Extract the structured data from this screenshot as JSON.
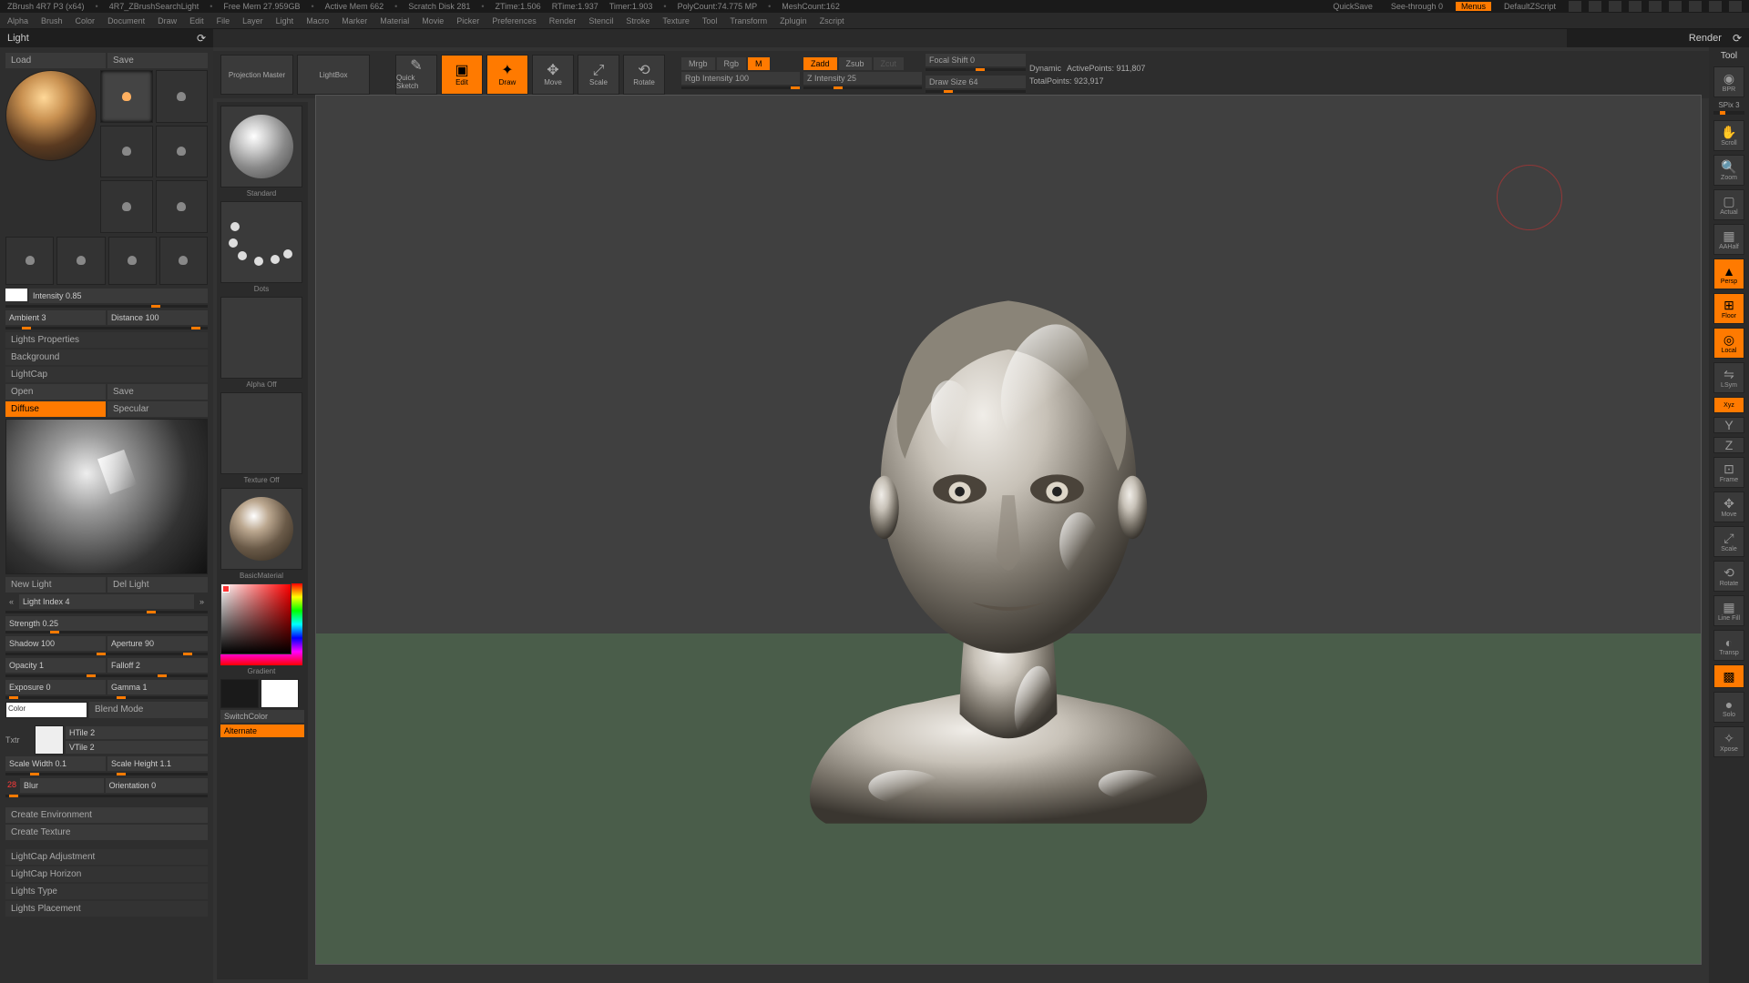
{
  "status": {
    "app": "ZBrush 4R7 P3 (x64)",
    "file": "4R7_ZBrushSearchLight",
    "freemem": "Free Mem 27.959GB",
    "activemem": "Active Mem 662",
    "scratch": "Scratch Disk 281",
    "ztime": "ZTime:1.506",
    "rtime": "RTime:1.937",
    "timer": "Timer:1.903",
    "polycount": "PolyCount:74.775 MP",
    "meshcount": "MeshCount:162",
    "quicksave": "QuickSave",
    "seethrough": "See-through  0",
    "menus": "Menus",
    "defaultscript": "DefaultZScript"
  },
  "menu": [
    "Alpha",
    "Brush",
    "Color",
    "Document",
    "Draw",
    "Edit",
    "File",
    "Layer",
    "Light",
    "Macro",
    "Marker",
    "Material",
    "Movie",
    "Picker",
    "Preferences",
    "Render",
    "Stencil",
    "Stroke",
    "Texture",
    "Tool",
    "Transform",
    "Zplugin",
    "Zscript"
  ],
  "palette": {
    "title": "Light",
    "render": "Render",
    "tool": "Tool"
  },
  "light": {
    "load": "Load",
    "save": "Save",
    "intensity": "Intensity 0.85",
    "ambient": "Ambient 3",
    "distance": "Distance 100",
    "propsHeader": "Lights Properties",
    "background": "Background",
    "lightcap": "LightCap",
    "open": "Open",
    "save2": "Save",
    "diffuse": "Diffuse",
    "specular": "Specular",
    "newlight": "New Light",
    "dellight": "Del Light",
    "lightindex": "Light Index 4",
    "strength": "Strength 0.25",
    "shadow": "Shadow 100",
    "aperture": "Aperture 90",
    "opacity": "Opacity 1",
    "falloff": "Falloff 2",
    "exposure": "Exposure 0",
    "gamma": "Gamma 1",
    "color": "Color",
    "blend": "Blend Mode",
    "txtr": "Txtr",
    "htile": "HTile 2",
    "vtile": "VTile 2",
    "scalew": "Scale Width 0.1",
    "scaleh": "Scale Height 1.1",
    "blur": "Blur",
    "blurval": "28",
    "orient": "Orientation 0",
    "createEnv": "Create Environment",
    "createTex": "Create Texture",
    "adj": "LightCap Adjustment",
    "horizon": "LightCap Horizon",
    "type": "Lights Type",
    "placement": "Lights Placement"
  },
  "tray": {
    "brush": "Standard",
    "stroke": "Dots",
    "alpha": "Alpha Off",
    "texture": "Texture Off",
    "material": "BasicMaterial",
    "gradient": "Gradient",
    "switchcolor": "SwitchColor",
    "alternate": "Alternate"
  },
  "toolbar": {
    "projection": "Projection Master",
    "lightbox": "LightBox",
    "quicksketch": "Quick Sketch",
    "edit": "Edit",
    "draw": "Draw",
    "move": "Move",
    "scale": "Scale",
    "rotate": "Rotate",
    "mrgb": "Mrgb",
    "rgb": "Rgb",
    "m": "M",
    "rgbint": "Rgb Intensity 100",
    "zadd": "Zadd",
    "zsub": "Zsub",
    "zcut": "Zcut",
    "zint": "Z Intensity 25",
    "focal": "Focal Shift 0",
    "drawsize": "Draw Size 64",
    "dynamic": "Dynamic",
    "active": "ActivePoints: 911,807",
    "total": "TotalPoints: 923,917"
  },
  "rightRail": {
    "bpr": "BPR",
    "spix": "SPix 3",
    "scroll": "Scroll",
    "zoom": "Zoom",
    "actual": "Actual",
    "aahalf": "AAHalf",
    "persp": "Persp",
    "floor": "Floor",
    "local": "Local",
    "lsym": "LSym",
    "xyz": "Xyz",
    "frame": "Frame",
    "move": "Move",
    "scale": "Scale",
    "rotate": "Rotate",
    "linefill": "Line Fill",
    "transp": "Transp",
    "solo": "Solo",
    "xpose": "Xpose"
  }
}
